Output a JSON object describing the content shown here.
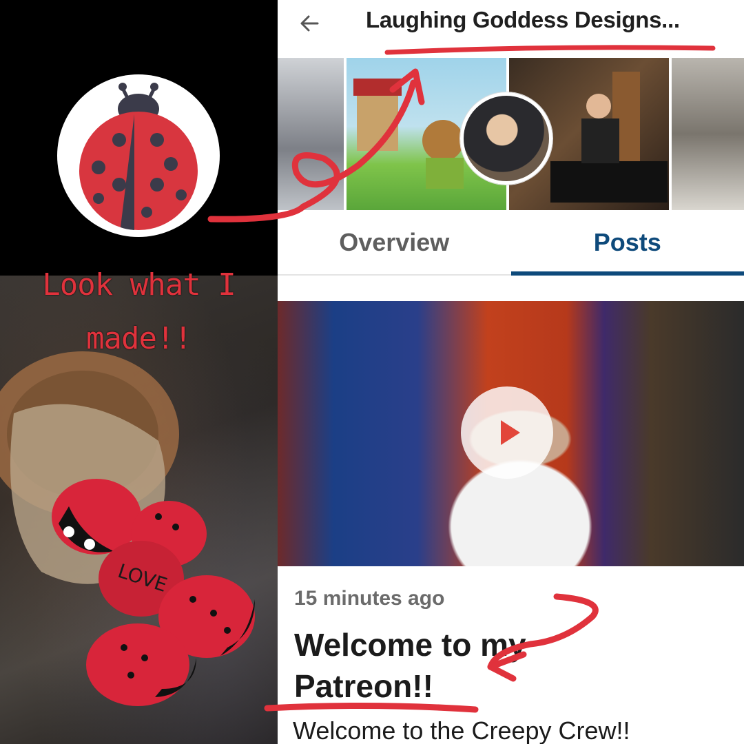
{
  "header": {
    "title": "Laughing Goddess Designs...",
    "back_icon": "arrow-left-icon"
  },
  "tabs": [
    {
      "label": "Overview",
      "active": false
    },
    {
      "label": "Posts",
      "active": true
    }
  ],
  "post": {
    "timestamp": "15 minutes ago",
    "title": "Welcome to my Patreon!!",
    "body": "Welcome to the Creepy Crew!!"
  },
  "collage": {
    "caption_line1": "Look what I",
    "caption_line2": "made!!",
    "rock_text": "LOVE"
  },
  "colors": {
    "accent_blue": "#0e4a7b",
    "annotation_red": "#e0323c",
    "ladybug_red": "#d8363f",
    "ladybug_dark": "#3b3b4a"
  }
}
